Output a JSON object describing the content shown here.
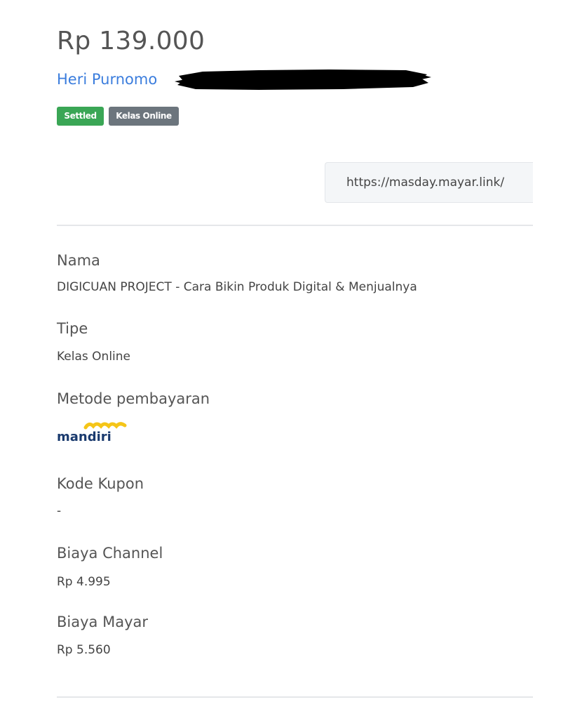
{
  "transaction": {
    "amount": "Rp 139.000",
    "customer_name": "Heri Purnomo",
    "status_badge": "Settled",
    "type_badge": "Kelas Online",
    "link": "https://masday.mayar.link/"
  },
  "details": {
    "name_label": "Nama",
    "name_value": "DIGICUAN PROJECT - Cara Bikin Produk Digital & Menjualnya",
    "type_label": "Tipe",
    "type_value": "Kelas Online",
    "payment_method_label": "Metode pembayaran",
    "payment_method_logo": "mandiri",
    "coupon_label": "Kode Kupon",
    "coupon_value": "-",
    "channel_fee_label": "Biaya Channel",
    "channel_fee_value": "Rp 4.995",
    "mayar_fee_label": "Biaya Mayar",
    "mayar_fee_value": "Rp 5.560"
  },
  "colors": {
    "link_blue": "#3b7ddd",
    "settled_green": "#3aa655",
    "badge_gray": "#6c757d",
    "mandiri_navy": "#1a3a6e",
    "mandiri_gold": "#f5c518"
  },
  "icons": {
    "redaction": "redaction-scribble",
    "payment_logo": "mandiri-logo"
  }
}
